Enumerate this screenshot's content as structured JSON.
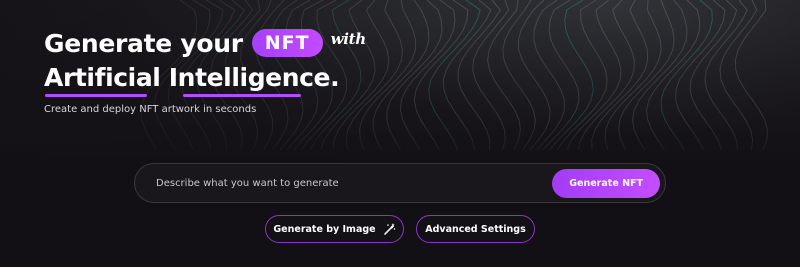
{
  "hero": {
    "title_part1": "Generate your",
    "badge": "NFT",
    "title_with": "with",
    "title_line2": "Artificial Intelligence.",
    "subtitle": "Create and deploy NFT artwork in seconds"
  },
  "prompt": {
    "value": "",
    "placeholder": "Describe what you want to generate",
    "generate_label": "Generate NFT"
  },
  "actions": {
    "by_image_label": "Generate by Image",
    "by_image_icon": "magic-wand-icon",
    "advanced_label": "Advanced Settings"
  },
  "colors": {
    "accent": "#b14cff",
    "background": "#141216",
    "button_border": "#8a35c8"
  }
}
